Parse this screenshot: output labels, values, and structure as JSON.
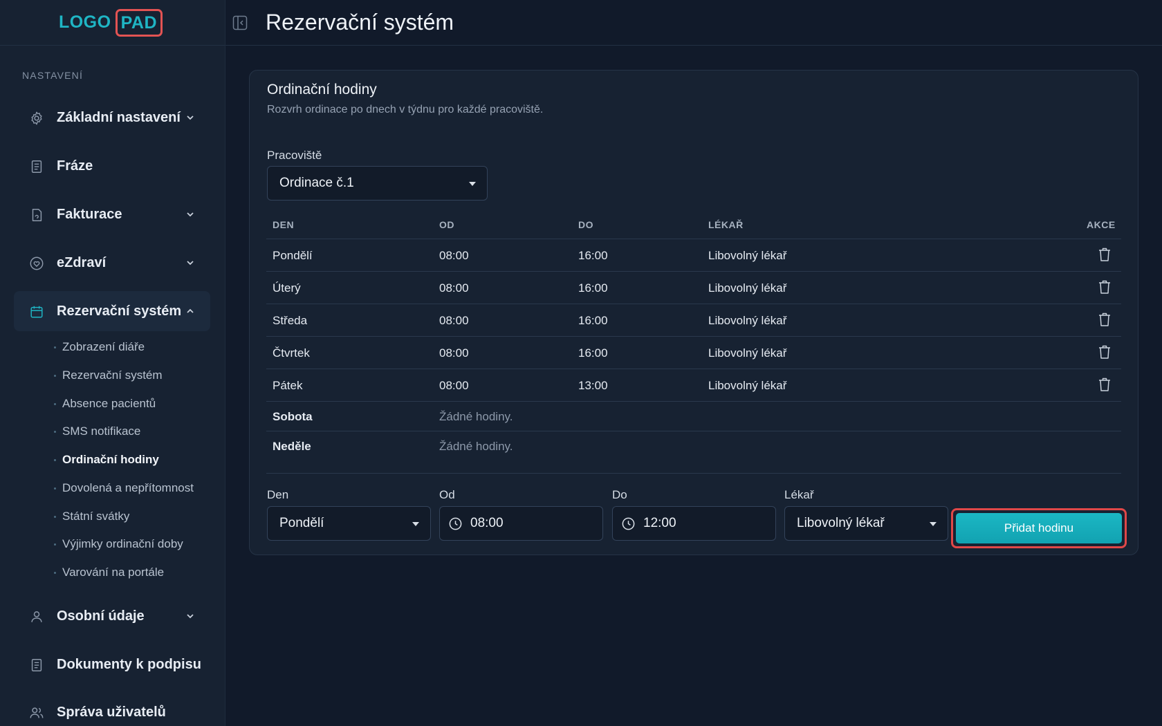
{
  "logo": {
    "left": "LOGO",
    "right": "PAD"
  },
  "sidebar": {
    "section_label": "NASTAVENÍ",
    "items": [
      {
        "label": "Základní nastavení",
        "icon": "gear-icon",
        "has_chevron": true
      },
      {
        "label": "Fráze",
        "icon": "document-icon",
        "has_chevron": false
      },
      {
        "label": "Fakturace",
        "icon": "invoice-icon",
        "has_chevron": true
      },
      {
        "label": "eZdraví",
        "icon": "heart-icon",
        "has_chevron": true
      },
      {
        "label": "Rezervační systém",
        "icon": "calendar-icon",
        "has_chevron": true,
        "active": true
      },
      {
        "label": "Osobní údaje",
        "icon": "user-icon",
        "has_chevron": true
      },
      {
        "label": "Dokumenty k podpisu",
        "icon": "document-icon",
        "has_chevron": false
      },
      {
        "label": "Správa uživatelů",
        "icon": "users-icon",
        "has_chevron": false
      }
    ],
    "subitems": [
      "Zobrazení diáře",
      "Rezervační systém",
      "Absence pacientů",
      "SMS notifikace",
      "Ordinační hodiny",
      "Dovolená a nepřítomnost",
      "Státní svátky",
      "Výjimky ordinační doby",
      "Varování na portále"
    ],
    "current_subitem": "Ordinační hodiny"
  },
  "header": {
    "title": "Rezervační systém"
  },
  "card": {
    "title": "Ordinační hodiny",
    "subtitle": "Rozvrh ordinace po dnech v týdnu pro každé pracoviště.",
    "workplace_label": "Pracoviště",
    "workplace_value": "Ordinace č.1"
  },
  "table": {
    "headers": [
      "DEN",
      "OD",
      "DO",
      "LÉKAŘ",
      "AKCE"
    ],
    "rows": [
      {
        "day": "Pondělí",
        "from": "08:00",
        "to": "16:00",
        "doctor": "Libovolný lékař"
      },
      {
        "day": "Úterý",
        "from": "08:00",
        "to": "16:00",
        "doctor": "Libovolný lékař"
      },
      {
        "day": "Středa",
        "from": "08:00",
        "to": "16:00",
        "doctor": "Libovolný lékař"
      },
      {
        "day": "Čtvrtek",
        "from": "08:00",
        "to": "16:00",
        "doctor": "Libovolný lékař"
      },
      {
        "day": "Pátek",
        "from": "08:00",
        "to": "13:00",
        "doctor": "Libovolný lékař"
      }
    ],
    "empty_rows": [
      {
        "day": "Sobota",
        "note": "Žádné hodiny."
      },
      {
        "day": "Neděle",
        "note": "Žádné hodiny."
      }
    ]
  },
  "form": {
    "day_label": "Den",
    "day_value": "Pondělí",
    "from_label": "Od",
    "from_value": "08:00",
    "to_label": "Do",
    "to_value": "12:00",
    "doctor_label": "Lékař",
    "doctor_value": "Libovolný lékař",
    "add_button": "Přidat hodinu"
  },
  "colors": {
    "accent": "#1bb7c4",
    "highlight": "#e04848",
    "background": "#111a2a"
  }
}
